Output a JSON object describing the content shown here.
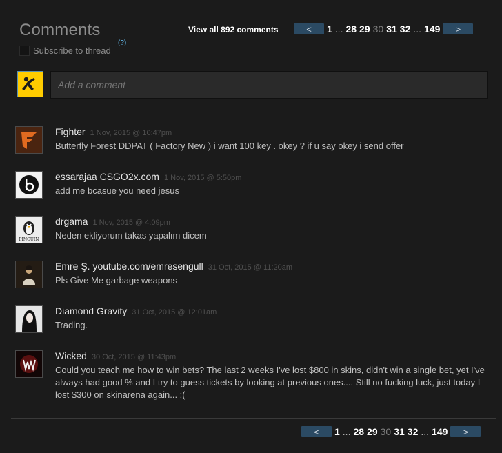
{
  "header": {
    "title": "Comments",
    "subscribe_label": "Subscribe to thread",
    "help_label": "(?)",
    "view_all": "View all 892 comments"
  },
  "pagination": {
    "prev": "<",
    "next": ">",
    "pages": [
      "1",
      "...",
      "28",
      "29",
      "30",
      "31",
      "32",
      "...",
      "149"
    ],
    "current": "30"
  },
  "composer": {
    "placeholder": "Add a comment"
  },
  "comments": [
    {
      "author": "Fighter",
      "time": "1 Nov, 2015 @ 10:47pm",
      "text": "Butterfly Forest DDPAT ( Factory New ) i want 100 key . okey ? if u say okey i send offer"
    },
    {
      "author": "essarajaa CSGO2x.com",
      "time": "1 Nov, 2015 @ 5:50pm",
      "text": "add me bcasue you need jesus"
    },
    {
      "author": "drgama",
      "time": "1 Nov, 2015 @ 4:09pm",
      "text": "Neden ekliyorum takas yapalım dicem"
    },
    {
      "author": "Emre Ş. youtube.com/emresengull",
      "time": "31 Oct, 2015 @ 11:20am",
      "text": "Pls Give Me garbage weapons"
    },
    {
      "author": "Diamond Gravity",
      "time": "31 Oct, 2015 @ 12:01am",
      "text": "Trading."
    },
    {
      "author": "Wicked",
      "time": "30 Oct, 2015 @ 11:43pm",
      "text": "Could you teach me how to win bets? The last 2 weeks I've lost $800 in skins, didn't win a single bet, yet I've always had good % and I try to guess tickets by looking at previous ones.... Still no fucking luck, just today I lost $300 on skinarena again... :("
    }
  ],
  "avatar_text": {
    "drgama": "PINGUIN"
  },
  "colors": {
    "background": "#1b1b1b",
    "pager_button": "#2b4a63",
    "link_blue": "#66c0f4",
    "composer_avatar": "#ffcc00"
  }
}
